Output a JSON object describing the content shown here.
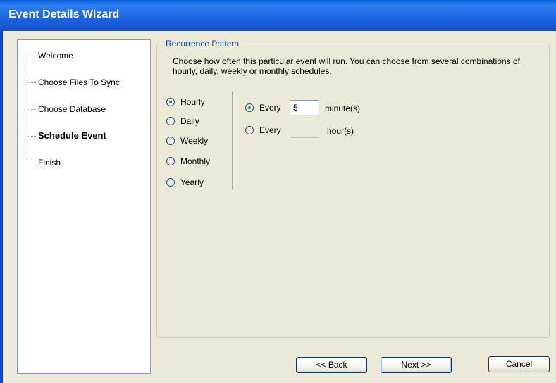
{
  "window": {
    "title": "Event Details Wizard"
  },
  "nav": {
    "items": [
      {
        "label": "Welcome",
        "active": false
      },
      {
        "label": "Choose Files To Sync",
        "active": false
      },
      {
        "label": "Choose Database",
        "active": false
      },
      {
        "label": "Schedule Event",
        "active": true
      },
      {
        "label": "Finish",
        "active": false
      }
    ]
  },
  "recurrence": {
    "legend": "Recurrence Pattern",
    "description": "Choose how often this particular event will run. You can choose from several combinations of hourly, daily, weekly or monthly schedules.",
    "frequencies": [
      {
        "label": "Hourly",
        "checked": true
      },
      {
        "label": "Daily",
        "checked": false
      },
      {
        "label": "Weekly",
        "checked": false
      },
      {
        "label": "Monthly",
        "checked": false
      },
      {
        "label": "Yearly",
        "checked": false
      }
    ],
    "minutes_option": {
      "label": "Every",
      "value": "5",
      "unit": "minute(s)",
      "checked": true
    },
    "hours_option": {
      "label": "Every",
      "value": "",
      "unit": "hour(s)",
      "checked": false
    }
  },
  "buttons": {
    "back": "<< Back",
    "next": "Next >>",
    "cancel": "Cancel"
  }
}
